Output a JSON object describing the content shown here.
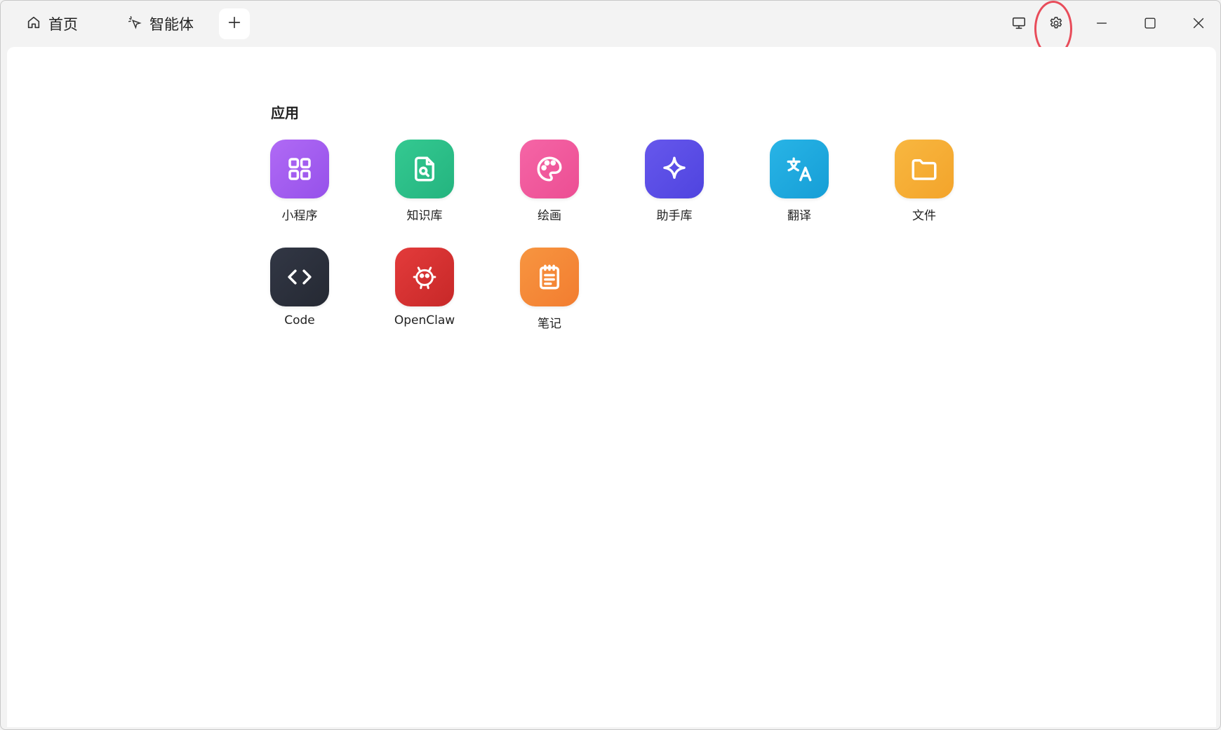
{
  "tabs": [
    {
      "label": "首页",
      "icon": "home-icon"
    },
    {
      "label": "智能体",
      "icon": "sparkle-cursor-icon"
    }
  ],
  "titlebar_buttons": [
    {
      "name": "display-icon"
    },
    {
      "name": "settings-gear-icon"
    },
    {
      "name": "minimize-icon"
    },
    {
      "name": "maximize-icon"
    },
    {
      "name": "close-icon"
    }
  ],
  "highlight_color": "#e84c5a",
  "section": {
    "title": "应用"
  },
  "apps": [
    {
      "label": "小程序",
      "icon": "grid-icon",
      "color": "#a05cf0"
    },
    {
      "label": "知识库",
      "icon": "document-search-icon",
      "color": "#2fbf8b"
    },
    {
      "label": "绘画",
      "icon": "palette-icon",
      "color": "#ef5b9c"
    },
    {
      "label": "助手库",
      "icon": "sparkle-icon",
      "color": "#5b4ee6"
    },
    {
      "label": "翻译",
      "icon": "translate-icon",
      "color": "#1fa9de"
    },
    {
      "label": "文件",
      "icon": "folder-icon",
      "color": "#f6ae33"
    },
    {
      "label": "Code",
      "icon": "code-icon",
      "color": "#2b2f3a"
    },
    {
      "label": "OpenClaw",
      "icon": "robot-icon",
      "color": "#d63232"
    },
    {
      "label": "笔记",
      "icon": "notepad-icon",
      "color": "#f5893a"
    }
  ]
}
